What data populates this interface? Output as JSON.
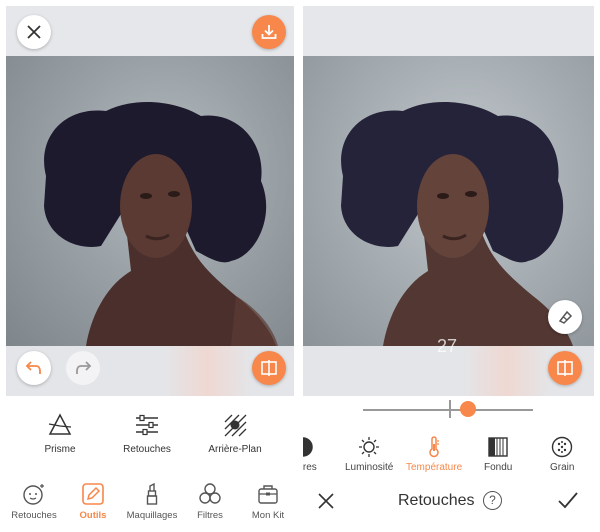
{
  "left": {
    "tools": [
      {
        "label": "Prisme",
        "icon": "prism-icon"
      },
      {
        "label": "Retouches",
        "icon": "sliders-icon"
      },
      {
        "label": "Arrière-Plan",
        "icon": "background-icon"
      }
    ],
    "nav": [
      {
        "label": "Retouches",
        "icon": "face-retouch-icon",
        "active": false
      },
      {
        "label": "Outils",
        "icon": "pencil-tool-icon",
        "active": true
      },
      {
        "label": "Maquillages",
        "icon": "lipstick-icon",
        "active": false
      },
      {
        "label": "Filtres",
        "icon": "filters-icon",
        "active": false
      },
      {
        "label": "Mon Kit",
        "icon": "kit-bag-icon",
        "active": false
      }
    ]
  },
  "right": {
    "value": "27",
    "slider_fraction": 0.62,
    "adjustments": [
      {
        "label": "mbres",
        "icon": "shadows-icon"
      },
      {
        "label": "Luminosité",
        "icon": "sun-icon"
      },
      {
        "label": "Température",
        "icon": "thermometer-icon",
        "active": true
      },
      {
        "label": "Fondu",
        "icon": "fade-icon"
      },
      {
        "label": "Grain",
        "icon": "grain-icon"
      }
    ],
    "title": "Retouches",
    "help": "?"
  },
  "colors": {
    "accent": "#f7874a",
    "toolbar_bg": "#e6e7ea"
  }
}
